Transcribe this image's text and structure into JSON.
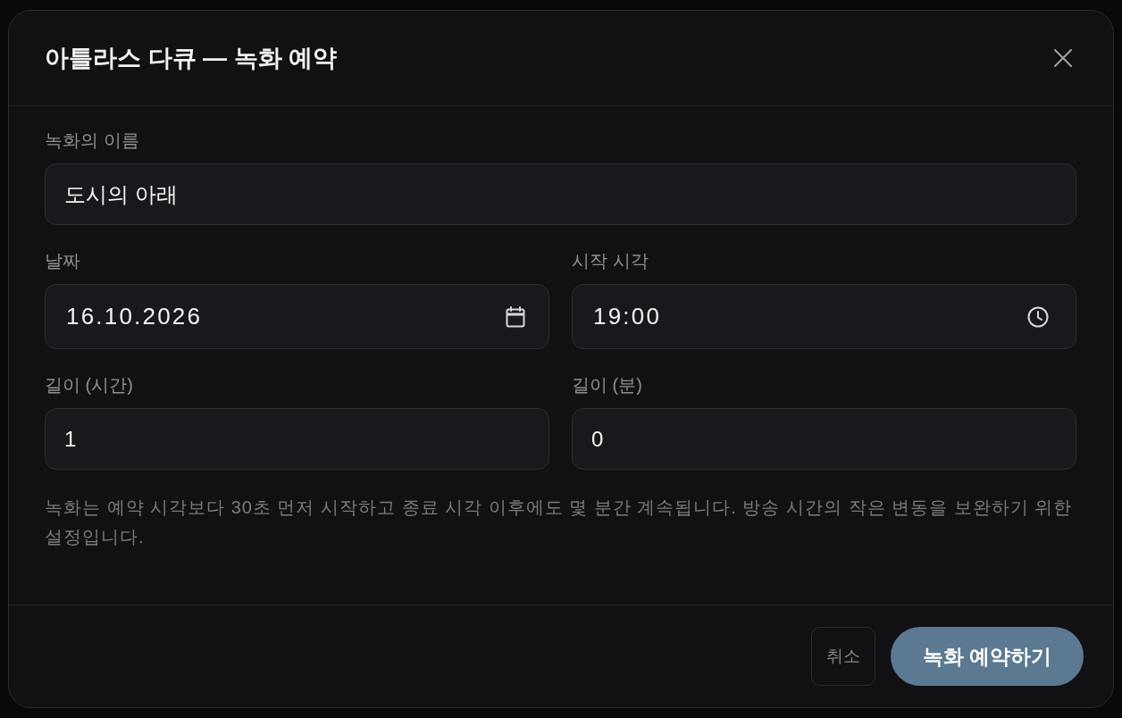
{
  "dialog": {
    "title": "아틀라스 다큐 — 녹화 예약"
  },
  "fields": [
    {
      "kind": "text",
      "label": "녹화의 이름",
      "value": "도시의 아래"
    },
    {
      "kind": "date",
      "label": "날짜",
      "value": "16.10.2026"
    },
    {
      "kind": "time",
      "label": "시작 시각",
      "value": "19:00"
    },
    {
      "kind": "number",
      "label": "길이 (시간)",
      "value": "1"
    },
    {
      "kind": "number",
      "label": "길이 (분)",
      "value": "0"
    }
  ],
  "help_text": "녹화는 예약 시각보다 30초 먼저 시작하고 종료 시각 이후에도 몇 분간 계속됩니다. 방송 시간의 작은 변동을 보완하기 위한 설정입니다.",
  "buttons": [
    {
      "kind": "secondary",
      "label": "취소"
    },
    {
      "kind": "primary",
      "label": "녹화 예약하기"
    }
  ]
}
